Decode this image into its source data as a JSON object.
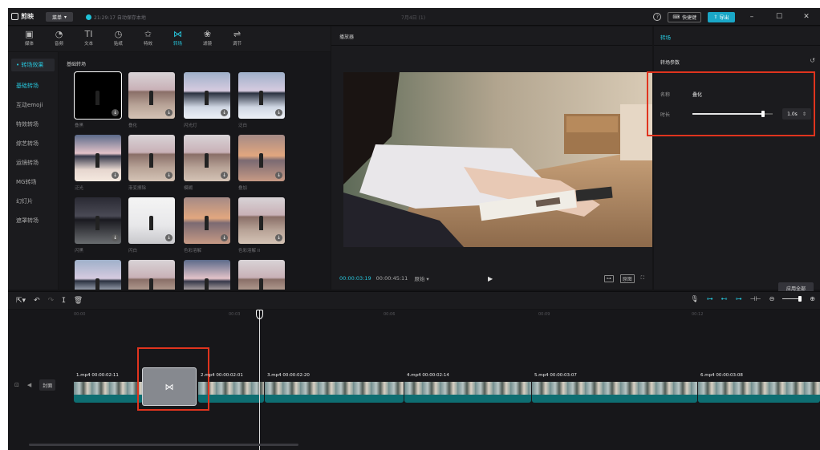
{
  "titlebar": {
    "app_name": "剪映",
    "menu_label": "菜单",
    "autosave": "21:29:17 自动保存本地",
    "project_title": "7月4日 (1)",
    "shortcut_label": "快捷键",
    "export_label": "导出"
  },
  "toolbar": {
    "tools": [
      {
        "glyph": "▣",
        "label": "媒体",
        "icon": "media-icon"
      },
      {
        "glyph": "◔",
        "label": "音频",
        "icon": "audio-icon"
      },
      {
        "glyph": "TI",
        "label": "文本",
        "icon": "text-icon"
      },
      {
        "glyph": "◷",
        "label": "贴纸",
        "icon": "sticker-icon"
      },
      {
        "glyph": "✩",
        "label": "特效",
        "icon": "effects-icon"
      },
      {
        "glyph": "⋈",
        "label": "转场",
        "icon": "transition-icon"
      },
      {
        "glyph": "❀",
        "label": "滤镜",
        "icon": "filter-icon"
      },
      {
        "glyph": "⇌",
        "label": "调节",
        "icon": "adjust-icon"
      }
    ],
    "active_index": 5
  },
  "categories": {
    "header": "• 转场效果",
    "items": [
      "基础转场",
      "互动emoji",
      "特效转场",
      "综艺转场",
      "运镜转场",
      "MG转场",
      "幻灯片",
      "遮罩转场"
    ],
    "active_index": 0
  },
  "grid": {
    "title": "基础转场",
    "items": [
      "叠黑",
      "叠化",
      "闪光灯",
      "泛白",
      "泛光",
      "渐变擦除",
      "模糊",
      "叠加",
      "闪黑",
      "闪白",
      "色彩溶解",
      "色彩溶解 II",
      "",
      "",
      "",
      ""
    ]
  },
  "player": {
    "title": "播放器",
    "current_time": "00:00:03:19",
    "total_time": "00:00:45:11",
    "ratio_label": "原始 ▾",
    "original_label": "原图"
  },
  "inspector": {
    "tab": "转场",
    "section": "转场参数",
    "name_label": "名称",
    "name_value": "叠化",
    "duration_label": "时长",
    "duration_value": "1.0s",
    "duration_fraction": 0.88,
    "apply_all": "应用全部"
  },
  "timeline": {
    "ticks": [
      "00:00",
      "00:03",
      "00:06",
      "00:09",
      "00:12"
    ],
    "cover_label": "封面",
    "clips": [
      {
        "label": "1.mp4  00:00:02:11"
      },
      {
        "label": "2.mp4  00:00:02:01"
      },
      {
        "label": "3.mp4  00:00:02:20"
      },
      {
        "label": "4.mp4  00:00:02:14"
      },
      {
        "label": "5.mp4  00:00:03:07"
      },
      {
        "label": "6.mp4  00:00:03:08"
      }
    ]
  },
  "colors": {
    "accent": "#27c6dc",
    "highlight": "#e0341e"
  }
}
